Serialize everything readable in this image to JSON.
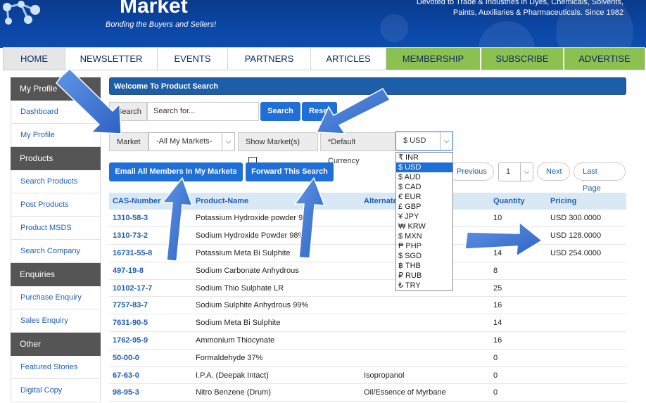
{
  "header": {
    "site_title": "Market",
    "tagline": "Bonding the Buyers and Sellers!",
    "description": "Devoted to Trade & Industries in Dyes, Chemicals, Solvents, Paints, Auxiliaries & Pharmaceuticals. Since 1982",
    "brand_color": "#0b47a6"
  },
  "nav": {
    "items": [
      {
        "label": "HOME"
      },
      {
        "label": "NEWSLETTER"
      },
      {
        "label": "EVENTS"
      },
      {
        "label": "PARTNERS"
      },
      {
        "label": "ARTICLES"
      },
      {
        "label": "MEMBERSHIP"
      },
      {
        "label": "SUBSCRIBE"
      },
      {
        "label": "ADVERTISE"
      }
    ],
    "green_color": "#8cc152"
  },
  "sidebar": {
    "sections": [
      {
        "title": "My Profile",
        "items": [
          "Dashboard",
          "My Profile"
        ]
      },
      {
        "title": "Products",
        "items": [
          "Search Products",
          "Post Products",
          "Product MSDS",
          "Search Company"
        ]
      },
      {
        "title": "Enquiries",
        "items": [
          "Purchase Enquiry",
          "Sales Enquiry"
        ]
      },
      {
        "title": "Other",
        "items": [
          "Featured Stories",
          "Digital Copy"
        ]
      }
    ]
  },
  "main": {
    "welcome": "Welcome To Product Search",
    "search": {
      "label": "Search",
      "placeholder": "Search for...",
      "search_button": "Search",
      "reset_button": "Reset"
    },
    "filters": {
      "market_label": "Market",
      "market_value": "-All My Markets-",
      "show_markets_label": "Show Market(s)",
      "currency_label": "*Default Currency",
      "currency_value": "$ USD"
    },
    "actions": {
      "email_all": "Email All Members In My Markets",
      "forward": "Forward This Search"
    },
    "pager": {
      "previous": "Previous",
      "page": "1",
      "next": "Next",
      "last": "Last Page"
    },
    "currency_options": [
      "₹ INR",
      "$ USD",
      "$ AUD",
      "$ CAD",
      "€ EUR",
      "£ GBP",
      "¥ JPY",
      "₩ KRW",
      "$ MXN",
      "₱ PHP",
      "$ SGD",
      "฿ THB",
      "₽ RUB",
      "₺ TRY"
    ],
    "currency_selected_index": 1,
    "table": {
      "headers": [
        "CAS-Number",
        "Product-Name",
        "Alternate",
        "",
        "Quantity",
        "Pricing"
      ],
      "rows": [
        {
          "cas": "1310-58-3",
          "name": "Potassium Hydroxide powder 9",
          "alt": "",
          "qty": "10",
          "price": "USD 300.0000"
        },
        {
          "cas": "1310-73-2",
          "name": "Sodium Hydroxide Powder 98%",
          "alt": "",
          "qty": "",
          "price": "USD 128.0000"
        },
        {
          "cas": "16731-55-8",
          "name": "Potassium Meta Bi Sulphite",
          "alt": "",
          "qty": "14",
          "price": "USD 254.0000"
        },
        {
          "cas": "497-19-8",
          "name": "Sodium Carbonate Anhydrous",
          "alt": "",
          "qty": "8",
          "price": ""
        },
        {
          "cas": "10102-17-7",
          "name": "Sodium Thio Sulphate LR",
          "alt": "",
          "qty": "25",
          "price": ""
        },
        {
          "cas": "7757-83-7",
          "name": "Sodium Sulphite Anhydrous 99%",
          "alt": "",
          "qty": "16",
          "price": ""
        },
        {
          "cas": "7631-90-5",
          "name": "Sodium Meta Bi Sulphite",
          "alt": "",
          "qty": "14",
          "price": ""
        },
        {
          "cas": "1762-95-9",
          "name": "Ammonium Thiocynate",
          "alt": "",
          "qty": "16",
          "price": ""
        },
        {
          "cas": "50-00-0",
          "name": "Formaldehyde 37%",
          "alt": "",
          "qty": "0",
          "price": ""
        },
        {
          "cas": "67-63-0",
          "name": "I.P.A. (Deepak Intact)",
          "alt": "Isopropanol",
          "qty": "0",
          "price": ""
        },
        {
          "cas": "98-95-3",
          "name": "Nitro Benzene (Drum)",
          "alt": "Oil/Essence of Myrbane",
          "qty": "0",
          "price": ""
        }
      ]
    }
  }
}
